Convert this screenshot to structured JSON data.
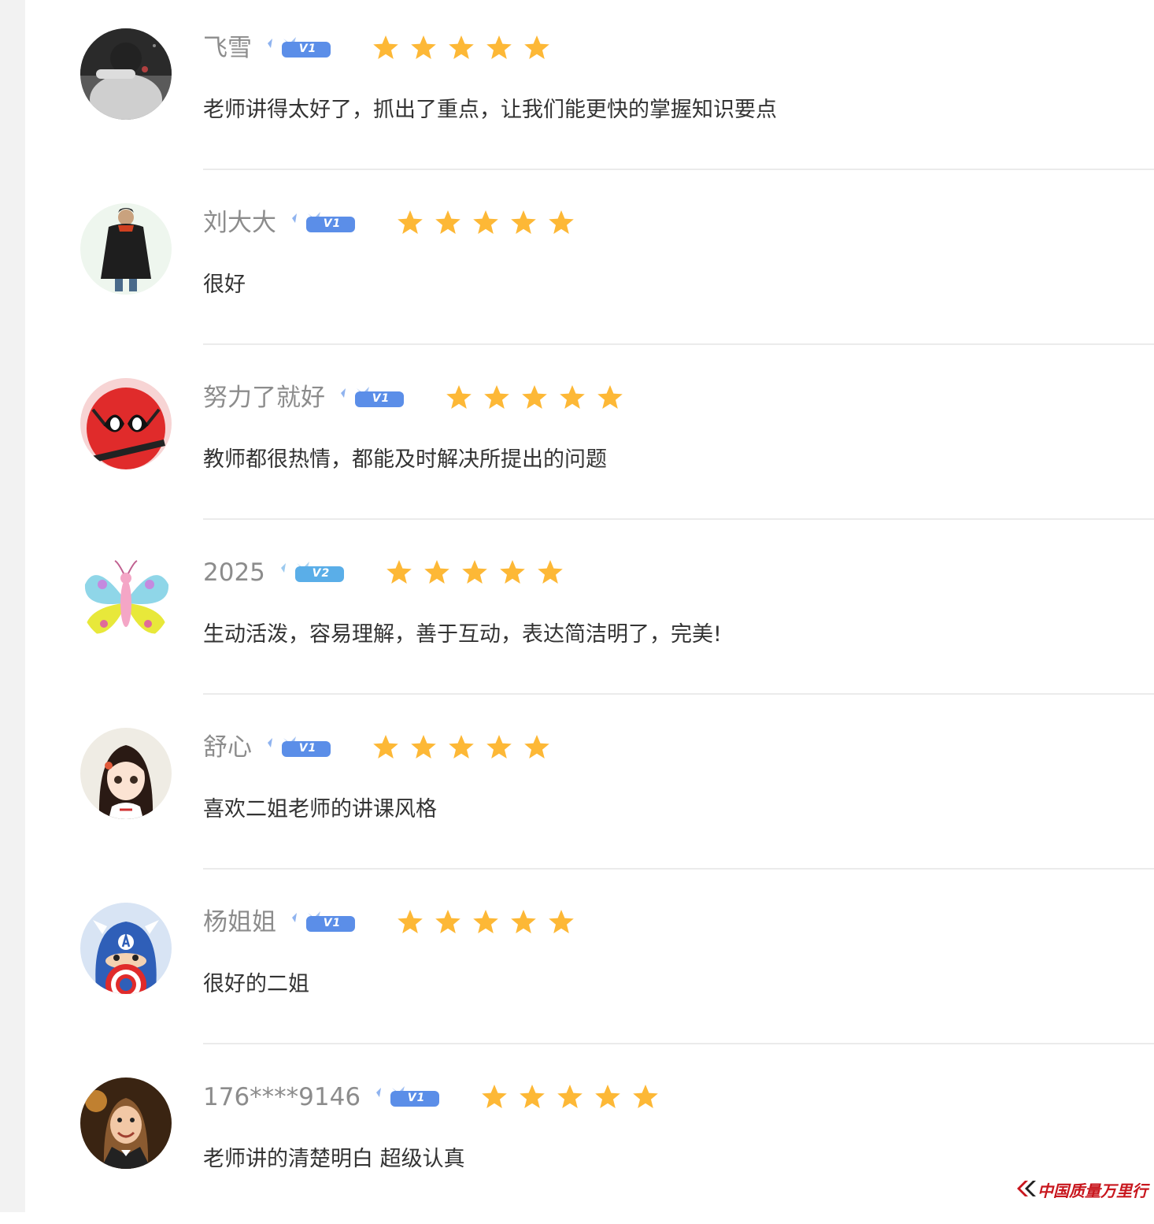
{
  "reviews": [
    {
      "username": "飞雪",
      "level": "V1",
      "rating": 5,
      "comment": "老师讲得太好了，抓出了重点，让我们能更快的掌握知识要点"
    },
    {
      "username": "刘大大",
      "level": "V1",
      "rating": 5,
      "comment": "很好"
    },
    {
      "username": "努力了就好",
      "level": "V1",
      "rating": 5,
      "comment": "教师都很热情，都能及时解决所提出的问题"
    },
    {
      "username": "2025",
      "level": "V2",
      "rating": 5,
      "comment": "生动活泼，容易理解，善于互动，表达简洁明了，完美!"
    },
    {
      "username": "舒心",
      "level": "V1",
      "rating": 5,
      "comment": "喜欢二姐老师的讲课风格"
    },
    {
      "username": "杨姐姐",
      "level": "V1",
      "rating": 5,
      "comment": "很好的二姐"
    },
    {
      "username": "176****9146",
      "level": "V1",
      "rating": 5,
      "comment": "老师讲的清楚明白 超级认真"
    }
  ],
  "watermark": {
    "text": "中国质量万里行"
  },
  "colors": {
    "star": "#fdb836",
    "badge_v1": "#5b8ee8",
    "badge_v2": "#5aaee8",
    "username": "#8c8c8c",
    "comment": "#333333",
    "divider": "#ebebeb",
    "watermark": "#c8161d"
  }
}
